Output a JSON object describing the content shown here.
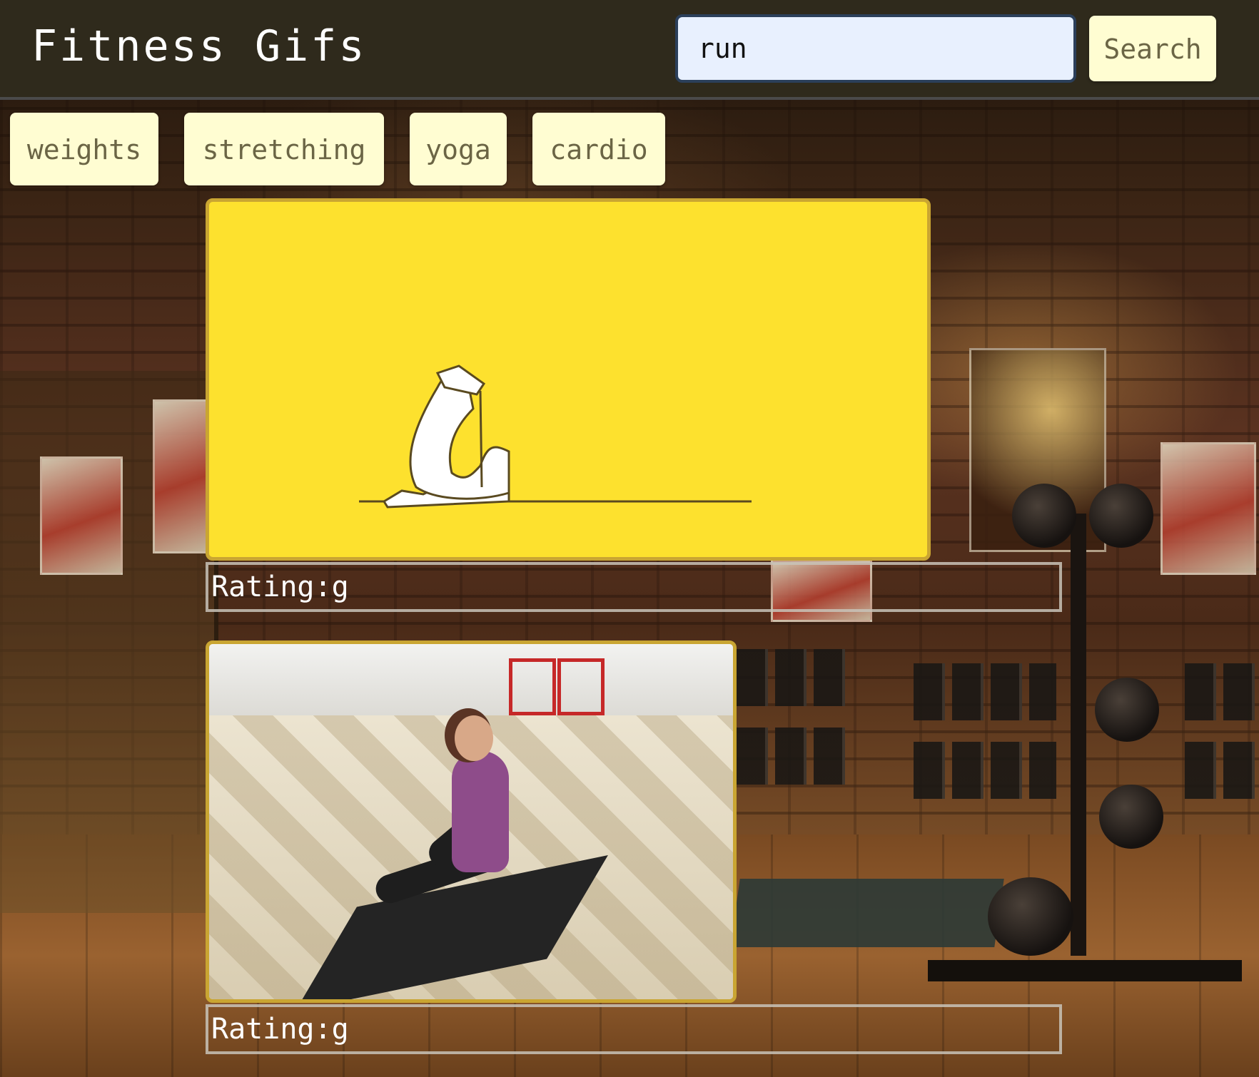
{
  "header": {
    "title": "Fitness Gifs",
    "search_value": "run",
    "search_button_label": "Search"
  },
  "topics": [
    {
      "label": "weights"
    },
    {
      "label": "stretching"
    },
    {
      "label": "yoga"
    },
    {
      "label": "cardio"
    }
  ],
  "results": [
    {
      "rating_text": "Rating:g",
      "description": "cartoon figure stretching on yellow background"
    },
    {
      "rating_text": "Rating:g",
      "description": "woman doing seated twist stretch on yoga mat"
    }
  ],
  "colors": {
    "header_bg": "#2f2a1c",
    "button_bg": "#fffdd2",
    "button_text": "#6b6545",
    "gif_border": "#c9a532",
    "gif1_bg": "#fde12e",
    "input_bg": "#e8f0fe"
  }
}
